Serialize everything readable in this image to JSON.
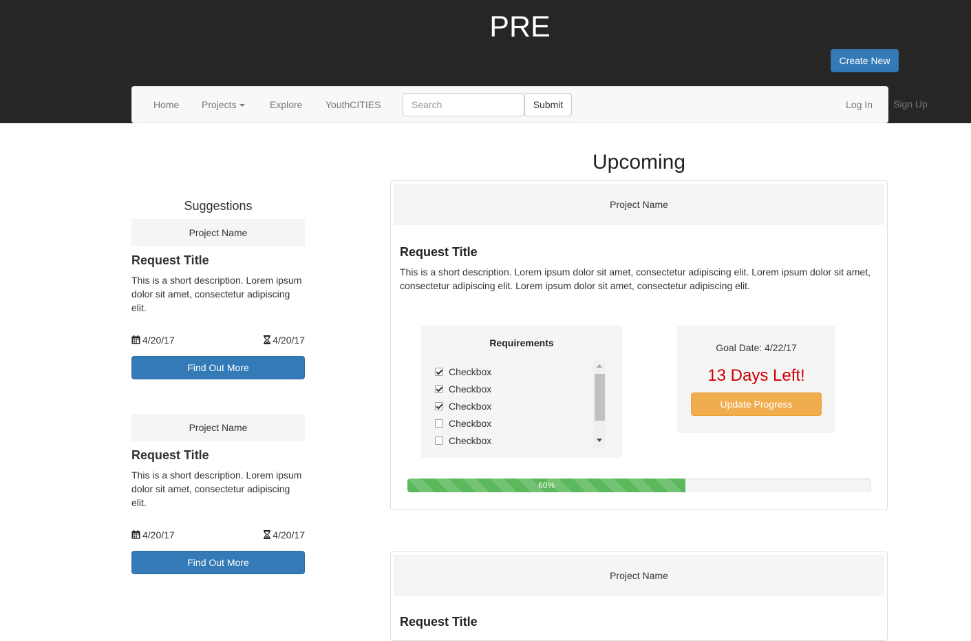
{
  "header": {
    "brand": "PRE",
    "create_label": "Create New"
  },
  "nav": {
    "items": [
      {
        "label": "Home"
      },
      {
        "label": "Projects"
      },
      {
        "label": "Explore"
      },
      {
        "label": "YouthCITIES"
      }
    ],
    "search_placeholder": "Search",
    "submit_label": "Submit",
    "login_label": "Log In",
    "signup_label": "Sign Up"
  },
  "suggestions": {
    "title": "Suggestions",
    "cards": [
      {
        "project_name": "Project Name",
        "title": "Request Title",
        "description": "This is a short description. Lorem ipsum dolor sit amet, consectetur adipiscing elit.",
        "start_date": "4/20/17",
        "end_date": "4/20/17",
        "button": "Find Out More"
      },
      {
        "project_name": "Project Name",
        "title": "Request Title",
        "description": "This is a short description. Lorem ipsum dolor sit amet, consectetur adipiscing elit.",
        "start_date": "4/20/17",
        "end_date": "4/20/17",
        "button": "Find Out More"
      }
    ]
  },
  "upcoming": {
    "title": "Upcoming",
    "panels": [
      {
        "project_name": "Project Name",
        "title": "Request Title",
        "description": "This is a short description. Lorem ipsum dolor sit amet, consectetur adipiscing elit. Lorem ipsum dolor sit amet, consectetur adipiscing elit. Lorem ipsum dolor sit amet, consectetur adipiscing elit.",
        "requirements_title": "Requirements",
        "checkboxes": [
          {
            "label": "Checkbox",
            "checked": true
          },
          {
            "label": "Checkbox",
            "checked": true
          },
          {
            "label": "Checkbox",
            "checked": true
          },
          {
            "label": "Checkbox",
            "checked": false
          },
          {
            "label": "Checkbox",
            "checked": false
          }
        ],
        "goal_date": "Goal Date: 4/22/17",
        "days_left": "13 Days Left!",
        "update_label": "Update Progress",
        "progress": 60,
        "progress_label": "60%"
      },
      {
        "project_name": "Project Name",
        "title": "Request Title"
      }
    ]
  },
  "colors": {
    "header_bg": "#282625",
    "primary": "#337ab7",
    "warning": "#f0ad4e",
    "success": "#5cb85c",
    "danger_text": "#cc0000"
  },
  "icons": [
    "calendar-icon",
    "hourglass-icon",
    "caret-down-icon",
    "scroll-up-arrow-icon",
    "scroll-down-arrow-icon"
  ]
}
